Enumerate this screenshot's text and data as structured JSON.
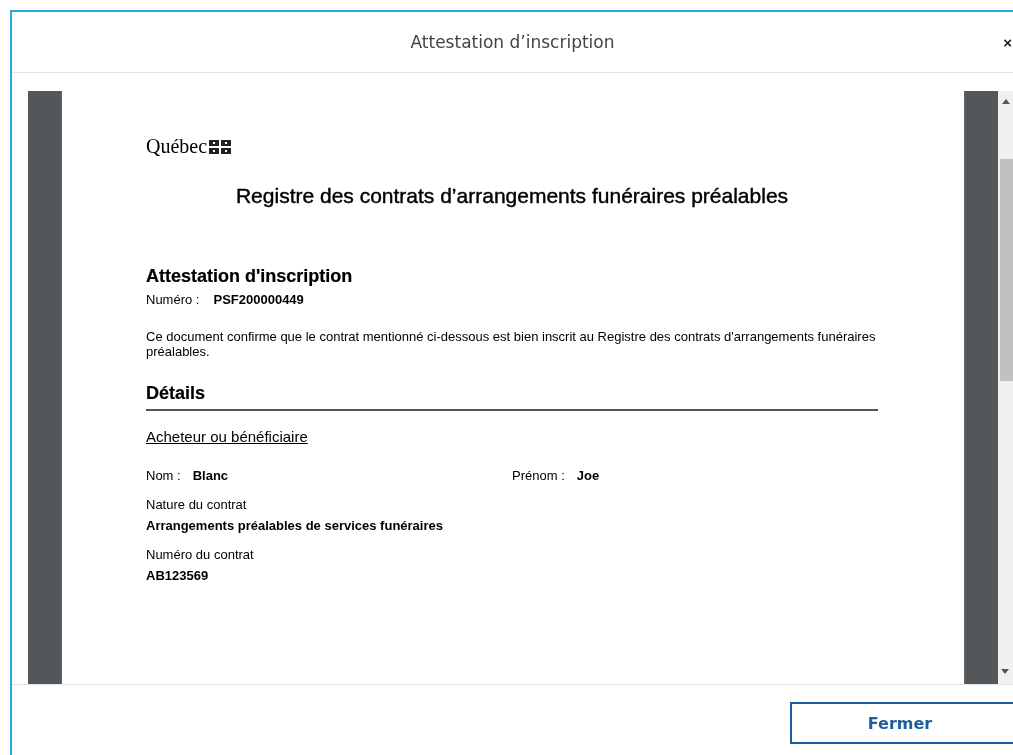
{
  "dialog": {
    "title": "Attestation d’inscription",
    "close": "×"
  },
  "document": {
    "logo": "Québec",
    "heading": "Registre des contrats d’arrangements funéraires préalables",
    "section_title": "Attestation d'inscription",
    "number_label": "Numéro :",
    "number": "PSF200000449",
    "paragraph": "Ce document confirme que le contrat mentionné ci-dessous est bien inscrit au Registre des contrats d'arrangements funéraires préalables.",
    "details_title": "Détails",
    "subsection": "Acheteur ou bénéficiaire",
    "pairs": [
      {
        "label": "Nom :",
        "value": "Blanc"
      },
      {
        "label": "Prénom :",
        "value": "Joe"
      }
    ],
    "fields": [
      {
        "label": "Nature du contrat",
        "value": "Arrangements préalables de services funéraires"
      },
      {
        "label": "Numéro du contrat",
        "value": "AB123569"
      }
    ]
  },
  "buttons": [
    "Fermer"
  ]
}
